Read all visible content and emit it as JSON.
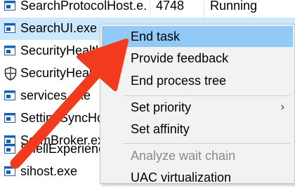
{
  "processes": [
    {
      "name": "SearchProtocolHost.e...",
      "pid": "4748",
      "status": "Running",
      "icon": "window-icon"
    },
    {
      "name": "SearchUI.exe",
      "pid": "",
      "status": "",
      "icon": "window-icon"
    },
    {
      "name": "SecurityHealth",
      "pid": "",
      "status": "",
      "icon": "window-icon"
    },
    {
      "name": "SecurityHealt",
      "pid": "",
      "status": "",
      "icon": "shield-icon"
    },
    {
      "name": "services.exe",
      "pid": "",
      "status": "",
      "icon": "window-icon"
    },
    {
      "name": "SettingSyncHo",
      "pid": "",
      "status": "",
      "icon": "window-icon"
    },
    {
      "name": "SgrmBroker.exe",
      "pid": "",
      "status": "",
      "icon": "window-icon"
    },
    {
      "name": "ShellExperienc",
      "pid": "",
      "status": "",
      "icon": "window-icon"
    },
    {
      "name": "sihost.exe",
      "pid": "",
      "status": "",
      "icon": "window-icon"
    }
  ],
  "context_menu": {
    "items": [
      {
        "label": "End task"
      },
      {
        "label": "Provide feedback"
      },
      {
        "label": "End process tree"
      },
      {
        "label": "Set priority",
        "submenu_glyph": "›"
      },
      {
        "label": "Set affinity"
      },
      {
        "label": "Analyze wait chain"
      },
      {
        "label": "UAC virtualization"
      }
    ]
  },
  "colors": {
    "selected_row": "#cce8ff",
    "menu_highlight": "#91c9f7",
    "arrow": "#f23a1e"
  }
}
